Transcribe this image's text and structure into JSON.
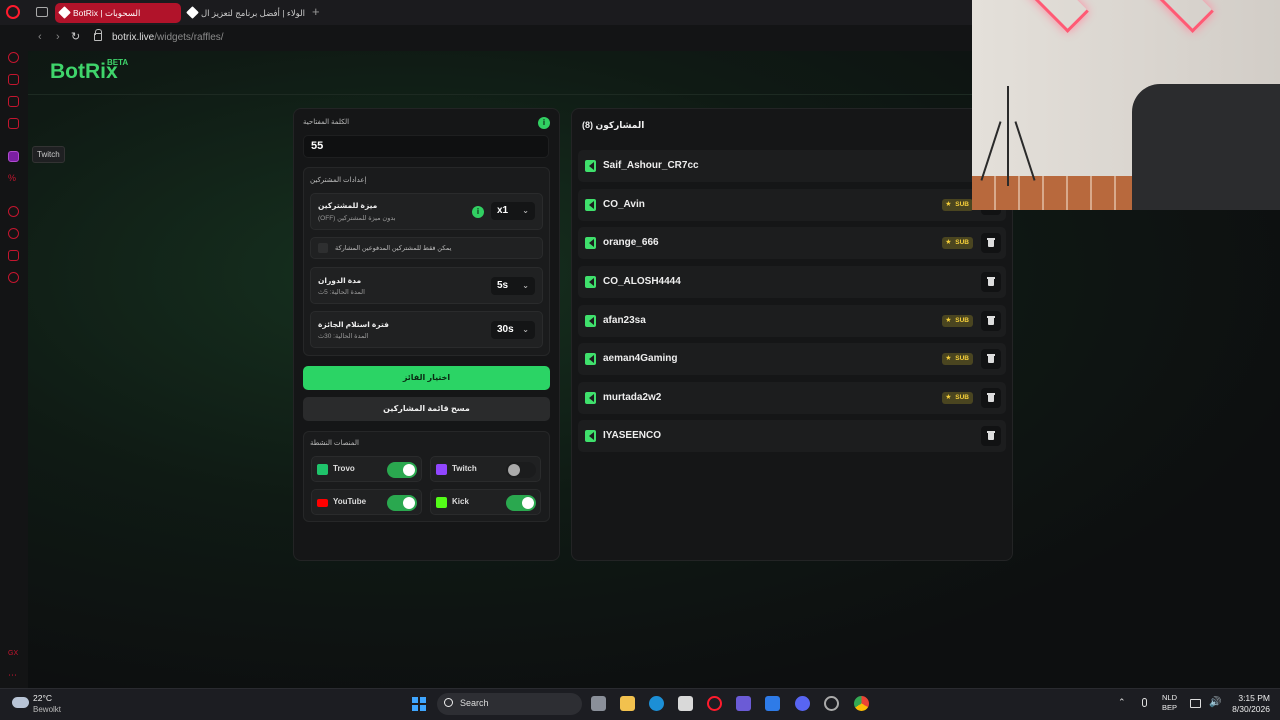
{
  "browser": {
    "tabs": [
      {
        "label": "BotRix | السحوبات",
        "active": true
      },
      {
        "label": "الولاء | أفضل برنامج لتعزيز ال",
        "active": false
      }
    ],
    "url_host": "botrix.live",
    "url_path": "/widgets/raffles/",
    "tooltip": "Twitch"
  },
  "app": {
    "logo": "BotRix",
    "logo_badge": "BETA"
  },
  "settings": {
    "keyword_label": "الكلمة المفتاحية",
    "keyword_value": "55",
    "subscriber_settings_title": "إعدادات المشتركين",
    "sub_advantage_title": "ميزة للمشتركين",
    "sub_advantage_desc": "بدون ميزة للمشتركين (OFF)",
    "sub_advantage_value": "x1",
    "followers_only_label": "يمكن فقط للمشتركين المدفوعين المشاركة",
    "spin_duration_title": "مدة الدوران",
    "spin_duration_desc": "المدة الحالية: 5ث",
    "spin_duration_value": "5s",
    "claim_period_title": "فترة استلام الجائزة",
    "claim_period_desc": "المدة الحالية: 30ث",
    "claim_period_value": "30s",
    "pick_winner": "اختيار الفائز",
    "clear_list": "مسح قائمة المشاركين",
    "active_platforms_title": "المنصات النشطة",
    "platforms": [
      {
        "name": "Trovo",
        "enabled": true,
        "color": "#1fc46b"
      },
      {
        "name": "Twitch",
        "enabled": false,
        "color": "#9146ff"
      },
      {
        "name": "YouTube",
        "enabled": true,
        "color": "#ff0000"
      },
      {
        "name": "Kick",
        "enabled": true,
        "color": "#53fc18"
      }
    ]
  },
  "participants": {
    "title": "المشاركون (8)",
    "sub_badge": "SUB",
    "list": [
      {
        "name": "Saif_Ashour_CR7cc",
        "sub": false
      },
      {
        "name": "CO_Avin",
        "sub": true
      },
      {
        "name": "orange_666",
        "sub": true
      },
      {
        "name": "CO_ALOSH4444",
        "sub": false
      },
      {
        "name": "afan23sa",
        "sub": true
      },
      {
        "name": "aeman4Gaming",
        "sub": true
      },
      {
        "name": "murtada2w2",
        "sub": true
      },
      {
        "name": "IYASEENCO",
        "sub": false
      }
    ]
  },
  "taskbar": {
    "weather_temp": "22°C",
    "weather_desc": "Bewolkt",
    "search_label": "Search",
    "lang_1": "NLD",
    "lang_2": "BEP",
    "time": "3:15 PM",
    "date": "8/30/2026"
  }
}
